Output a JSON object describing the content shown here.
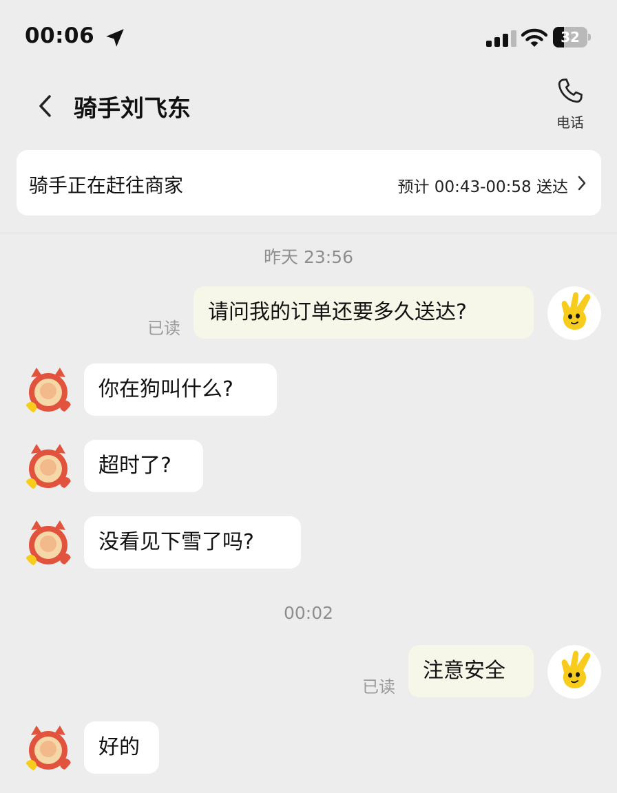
{
  "status_bar": {
    "time": "00:06",
    "battery": "32",
    "battery_percent": 32
  },
  "header": {
    "title": "骑手刘飞东",
    "call_label": "电话"
  },
  "status_card": {
    "title": "骑手正在赶往商家",
    "eta": "预计 00:43-00:58 送达"
  },
  "messages": {
    "ts1": "昨天 23:56",
    "m1": {
      "text": "请问我的订单还要多久送达?",
      "read": "已读"
    },
    "m2": {
      "text": "你在狗叫什么?"
    },
    "m3": {
      "text": "超时了?"
    },
    "m4": {
      "text": "没看见下雪了吗?"
    },
    "ts2": "00:02",
    "m5": {
      "text": "注意安全",
      "read": "已读"
    },
    "m6": {
      "text": "好的"
    }
  },
  "icons": {
    "location": "location-arrow-icon",
    "signal": "signal-icon",
    "wifi": "wifi-icon",
    "battery": "battery-icon",
    "back": "back-chevron-icon",
    "phone": "phone-icon",
    "chevron": "chevron-right-icon"
  },
  "colors": {
    "background": "#ededed",
    "outgoing_bubble": "#f6f6e9",
    "incoming_bubble": "#ffffff",
    "user_avatar_yellow": "#f8cc1c",
    "rider_avatar_red": "#e2533d"
  }
}
